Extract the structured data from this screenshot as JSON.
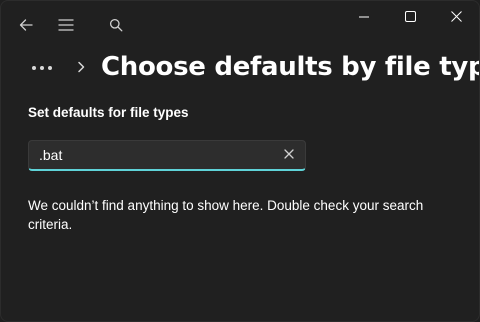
{
  "titlebar": {
    "back_icon": "back-arrow-icon",
    "menu_icon": "hamburger-menu-icon",
    "search_icon": "search-icon",
    "minimize_icon": "minimize-icon",
    "maximize_icon": "maximize-icon",
    "close_icon": "close-icon"
  },
  "header": {
    "breadcrumb_more_icon": "more-ellipsis-icon",
    "breadcrumb_separator_icon": "chevron-right-icon",
    "title": "Choose defaults by file type"
  },
  "main": {
    "section_label": "Set defaults for file types",
    "search": {
      "value": ".bat",
      "placeholder": "",
      "clear_icon": "clear-x-icon"
    },
    "empty_message": "We couldn’t find anything to show here. Double check your search criteria."
  },
  "colors": {
    "background": "#202020",
    "accent": "#5fd3d8",
    "text": "#ffffff",
    "input_background": "#2d2d2d"
  }
}
